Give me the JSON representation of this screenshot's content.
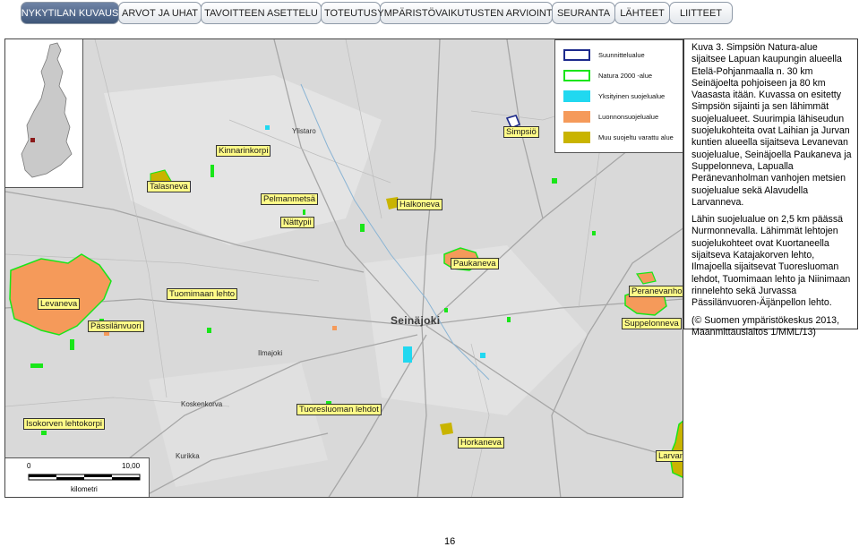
{
  "nav": {
    "tabs": [
      {
        "label": "NYKYTILAN KUVAUS",
        "active": true
      },
      {
        "label": "ARVOT JA UHAT",
        "active": false
      },
      {
        "label": "TAVOITTEEN ASETTELU",
        "active": false
      },
      {
        "label": "TOTEUTUS",
        "active": false
      },
      {
        "label": "YMPÄRISTÖVAIKUTUSTEN ARVIOINTI",
        "active": false
      },
      {
        "label": "SEURANTA",
        "active": false
      },
      {
        "label": "LÄHTEET",
        "active": false
      },
      {
        "label": "LIITTEET",
        "active": false
      }
    ]
  },
  "legend": {
    "items": [
      {
        "label": "Suunnittelualue",
        "fill": "#ffffff",
        "border": "#1c2a8c"
      },
      {
        "label": "Natura 2000 -alue",
        "fill": "#ffffff",
        "border": "#19e619"
      },
      {
        "label": "Yksityinen suojelualue",
        "fill": "#21d8f0",
        "border": "#21d8f0"
      },
      {
        "label": "Luonnonsuojelualue",
        "fill": "#f59a5a",
        "border": "#f59a5a"
      },
      {
        "label": "Muu suojeltu varattu alue",
        "fill": "#c9b400",
        "border": "#c9b400"
      }
    ]
  },
  "map": {
    "colors": {
      "protected_area": "#f59a5a",
      "natura": "#19e619",
      "private": "#21d8f0",
      "reserved": "#c9b400",
      "planning_area": "#1c2a8c"
    },
    "places": [
      {
        "label": "Simpsiö",
        "style": "boxed"
      },
      {
        "label": "Kinnarinkorpi",
        "style": "boxed"
      },
      {
        "label": "Talasneva",
        "style": "boxed"
      },
      {
        "label": "Pelmanmetsä",
        "style": "boxed"
      },
      {
        "label": "Halkoneva",
        "style": "boxed"
      },
      {
        "label": "Nättypii",
        "style": "boxed"
      },
      {
        "label": "Paukaneva",
        "style": "boxed"
      },
      {
        "label": "Levaneva",
        "style": "boxed"
      },
      {
        "label": "Tuomimaan lehto",
        "style": "boxed"
      },
      {
        "label": "Pässilänvuori",
        "style": "boxed"
      },
      {
        "label": "Peranevanholma",
        "style": "boxed"
      },
      {
        "label": "Suppelonneva",
        "style": "boxed"
      },
      {
        "label": "Tuoresluoman lehdot",
        "style": "boxed"
      },
      {
        "label": "Isokorven lehtokorpi",
        "style": "boxed"
      },
      {
        "label": "Horkaneva",
        "style": "boxed"
      },
      {
        "label": "Larvanneva",
        "style": "boxed"
      },
      {
        "label": "Seinäjoki",
        "style": "city"
      },
      {
        "label": "Ylistaro",
        "style": "plain"
      },
      {
        "label": "Ilmajoki",
        "style": "plain"
      },
      {
        "label": "Koskenkorva",
        "style": "plain"
      },
      {
        "label": "Kurikka",
        "style": "plain"
      }
    ],
    "scale": {
      "start": "0",
      "end": "10,00",
      "unit": "kilometri"
    }
  },
  "caption": {
    "p1": "Kuva 3. Simpsiön Natura-alue sijaitsee Lapuan kaupungin alueella Etelä-Pohjanmaalla n. 30 km Seinäjoelta pohjoiseen ja 80 km Vaasasta itään. Kuvassa on esitetty Simpsiön sijainti ja sen lähimmät suojelualueet. Suurimpia lähiseudun suojelukohteita ovat Laihian ja Jurvan kuntien alueella sijaitseva Levanevan suojelualue, Seinäjoella Paukaneva ja Suppelonneva, Lapualla Peränevanholman vanhojen metsien suojelualue sekä Alavudella Larvanneva.",
    "p2": "Lähin suojelualue on 2,5 km päässä Nurmonnevalla. Lähimmät lehtojen suojelukohteet ovat Kuortaneella sijaitseva Katajakorven lehto, Ilmajoella sijaitsevat Tuoresluoman lehdot, Tuomimaan lehto ja Niinimaan rinnelehto sekä Jurvassa Pässilänvuoren-Äijänpellon lehto.",
    "p3": "(© Suomen ympäristökeskus 2013, Maanmittauslaitos 1/MML/13)"
  },
  "page_number": "16"
}
